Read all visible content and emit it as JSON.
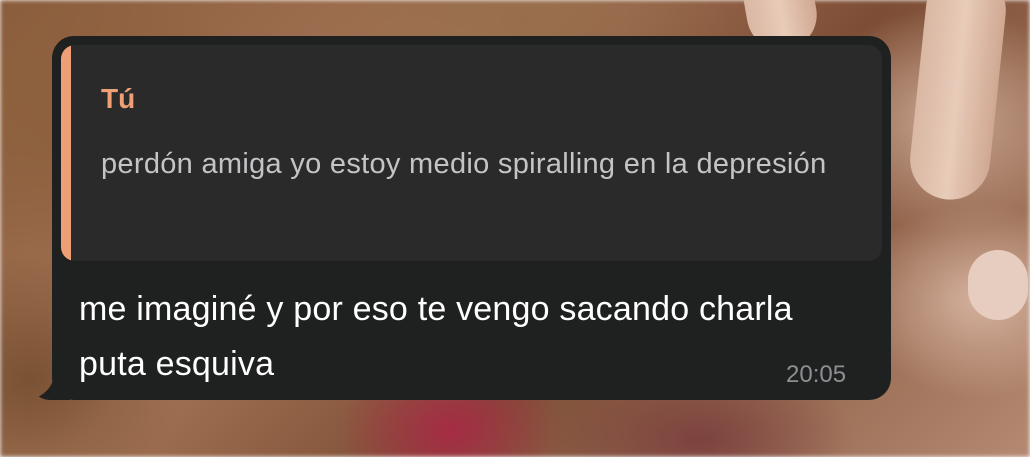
{
  "message": {
    "reply": {
      "author": "Tú",
      "text": "perdón amiga yo estoy medio spiralling en la depresión",
      "accent_color": "#ef9f76"
    },
    "text": "me imaginé y por eso te vengo sacando charla puta esquiva",
    "time": "20:05",
    "bubble_color": "#1f2020"
  }
}
